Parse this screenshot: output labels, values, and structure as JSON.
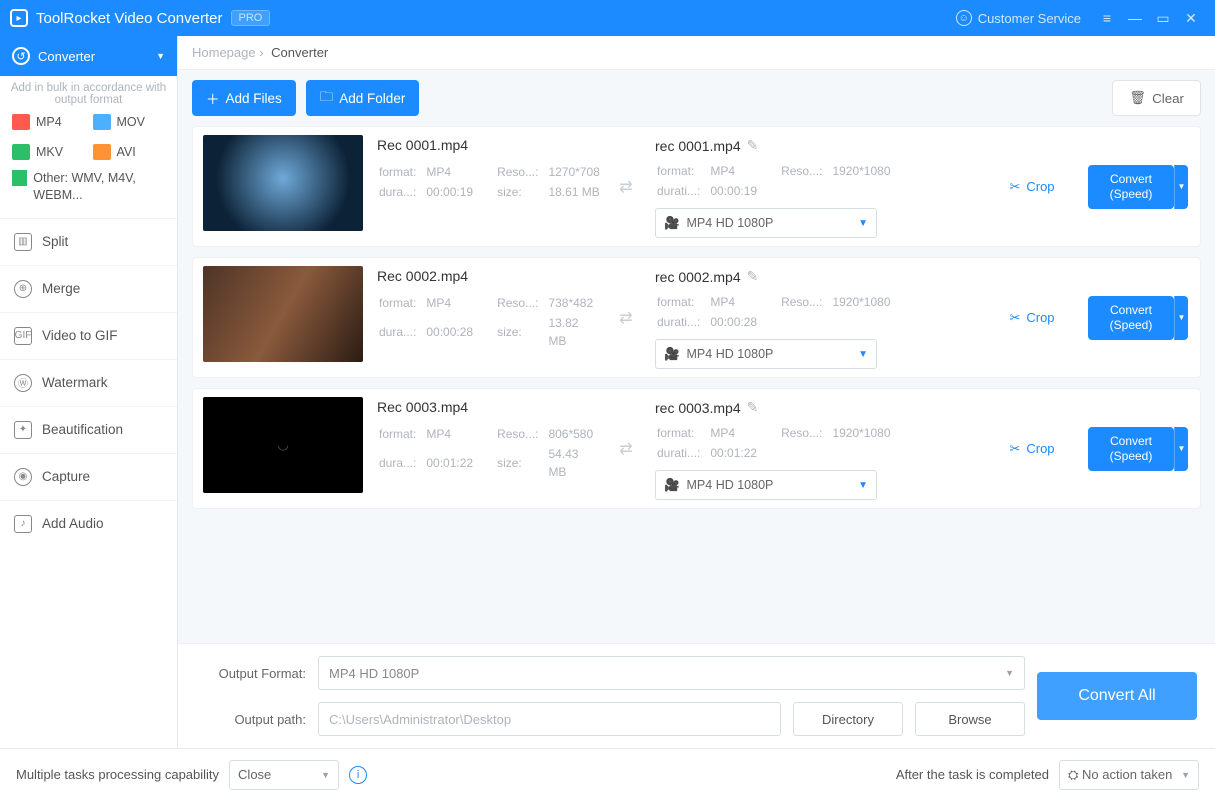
{
  "title": {
    "app": "ToolRocket Video Converter",
    "badge": "PRO",
    "customer_service": "Customer Service"
  },
  "sidebar": {
    "selector": "Converter",
    "note": "Add in bulk in accordance with output format",
    "formats": [
      {
        "label": "MP4",
        "color": "fi-red"
      },
      {
        "label": "MOV",
        "color": "fi-blue"
      },
      {
        "label": "MKV",
        "color": "fi-green"
      },
      {
        "label": "AVI",
        "color": "fi-orange"
      }
    ],
    "other": "Other: WMV, M4V, WEBM...",
    "items": [
      "Split",
      "Merge",
      "Video to GIF",
      "Watermark",
      "Beautification",
      "Capture",
      "Add Audio"
    ]
  },
  "crumb": {
    "root": "Homepage",
    "current": "Converter"
  },
  "toolbar": {
    "add_files": "Add Files",
    "add_folder": "Add Folder",
    "clear": "Clear"
  },
  "rows": [
    {
      "thumb": "tA",
      "src": {
        "name": "Rec 0001.mp4",
        "format": "MP4",
        "reso": "1270*708",
        "dura": "00:00:19",
        "size": "18.61 MB"
      },
      "dst": {
        "name": "rec 0001.mp4",
        "format": "MP4",
        "reso": "1920*1080",
        "dura": "00:00:19",
        "profile": "MP4  HD 1080P"
      },
      "crop": "Crop",
      "convert": "Convert",
      "speed": "(Speed)"
    },
    {
      "thumb": "tB",
      "src": {
        "name": "Rec 0002.mp4",
        "format": "MP4",
        "reso": "738*482",
        "dura": "00:00:28",
        "size": "13.82 MB"
      },
      "dst": {
        "name": "rec 0002.mp4",
        "format": "MP4",
        "reso": "1920*1080",
        "dura": "00:00:28",
        "profile": "MP4  HD 1080P"
      },
      "crop": "Crop",
      "convert": "Convert",
      "speed": "(Speed)"
    },
    {
      "thumb": "tC",
      "src": {
        "name": "Rec 0003.mp4",
        "format": "MP4",
        "reso": "806*580",
        "dura": "00:01:22",
        "size": "54.43 MB"
      },
      "dst": {
        "name": "rec 0003.mp4",
        "format": "MP4",
        "reso": "1920*1080",
        "dura": "00:01:22",
        "profile": "MP4  HD 1080P"
      },
      "crop": "Crop",
      "convert": "Convert",
      "speed": "(Speed)"
    }
  ],
  "labels": {
    "format": "format:",
    "reso": "Reso...:",
    "dura": "dura...:",
    "durati": "durati...:",
    "size": "size:"
  },
  "out": {
    "format_label": "Output Format:",
    "format_value": "MP4  HD 1080P",
    "path_label": "Output path:",
    "path_value": "C:\\Users\\Administrator\\Desktop",
    "directory": "Directory",
    "browse": "Browse",
    "convert_all": "Convert All"
  },
  "status": {
    "multi_label": "Multiple tasks processing capability",
    "multi_value": "Close",
    "after_label": "After the task is completed",
    "after_value": "No action taken"
  }
}
